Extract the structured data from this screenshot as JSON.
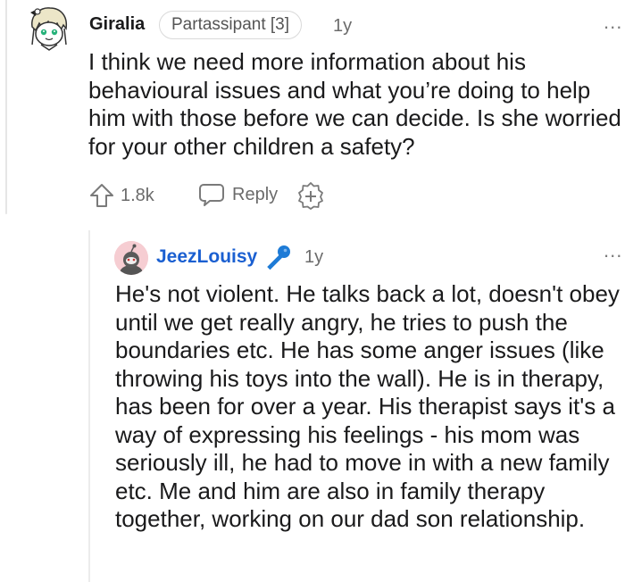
{
  "comment1": {
    "username": "Giralia",
    "flair": "Partassipant [3]",
    "time": "1y",
    "more": "...",
    "body": "I think we need more information about his behavioural issues and what you’re doing to help him with those before we can decide. Is she worried for your other children a safety?",
    "upvotes": "1.8k",
    "reply_label": "Reply"
  },
  "comment2": {
    "username": "JeezLouisy",
    "time": "1y",
    "more": "...",
    "body": "He's not violent. He talks back a lot, doesn't obey until we get really angry, he tries to push the boundaries etc. He has some anger issues (like throwing his toys into the wall). He is in therapy, has been for over a year. His therapist says it's a way of expressing his feelings - his mom was seriously ill, he had to move in with a new family etc. Me and him are also in family therapy together, working on our dad son relationship."
  },
  "colors": {
    "username_link": "#1a5fd1",
    "mic_badge": "#1e7bd6",
    "meta_gray": "#6b6b6b"
  }
}
